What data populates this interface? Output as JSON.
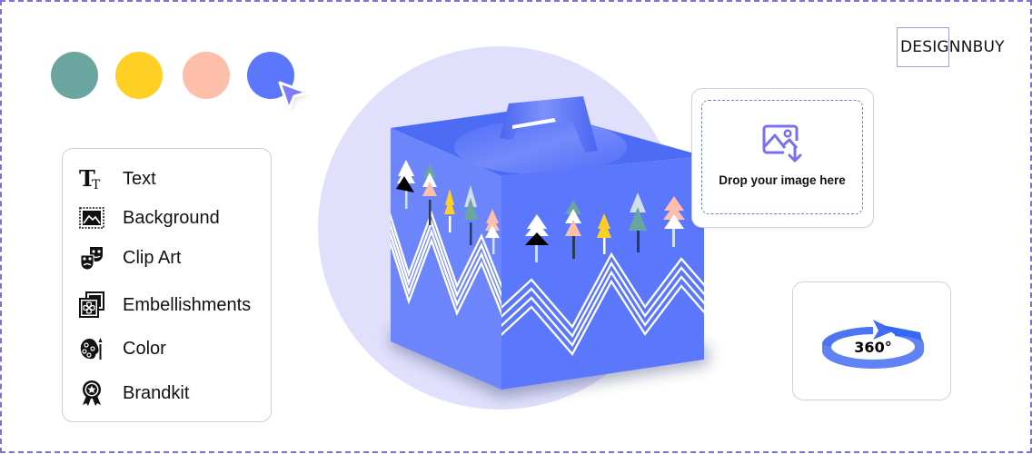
{
  "brand": {
    "name": "DESIGNNBUY"
  },
  "swatches": [
    {
      "name": "teal",
      "color": "#6ba5a0"
    },
    {
      "name": "yellow",
      "color": "#fdd023"
    },
    {
      "name": "peach",
      "color": "#fdbfaa"
    },
    {
      "name": "blue",
      "color": "#5b77fb"
    }
  ],
  "tools": [
    {
      "label": "Text",
      "icon": "text-icon"
    },
    {
      "label": "Background",
      "icon": "background-icon"
    },
    {
      "label": "Clip Art",
      "icon": "clip-art-icon"
    },
    {
      "label": "Embellishments",
      "icon": "embellishments-icon"
    },
    {
      "label": "Color",
      "icon": "color-palette-icon"
    },
    {
      "label": "Brandkit",
      "icon": "brandkit-badge-icon"
    }
  ],
  "dropzone": {
    "label": "Drop your image here",
    "icon": "image-download-icon"
  },
  "view360": {
    "label": "360°",
    "icon": "rotate-360-icon"
  },
  "colors": {
    "accent": "#5b77fb",
    "frame": "#7a72d8",
    "circle_bg": "#e1e0fc",
    "icon_purple": "#7a6ff0"
  }
}
